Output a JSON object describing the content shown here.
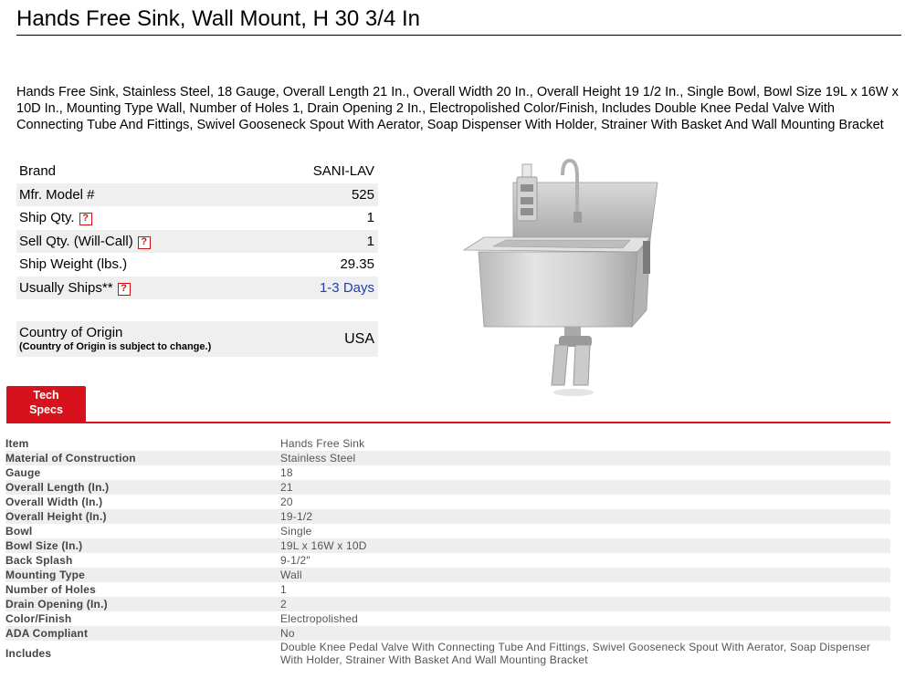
{
  "title": "Hands Free Sink, Wall Mount, H 30 3/4 In",
  "description": "Hands Free Sink, Stainless Steel, 18 Gauge, Overall Length 21 In., Overall Width 20 In., Overall Height 19 1/2 In., Single Bowl, Bowl Size 19L x 16W x 10D In., Mounting Type Wall, Number of Holes 1, Drain Opening 2 In., Electropolished Color/Finish, Includes Double Knee Pedal Valve With Connecting Tube And Fittings, Swivel Gooseneck Spout With Aerator, Soap Dispenser With Holder, Strainer With Basket And Wall Mounting Bracket",
  "props": {
    "brand": {
      "label": "Brand",
      "value": "SANI-LAV"
    },
    "model": {
      "label": "Mfr. Model #",
      "value": "525"
    },
    "ship_qty": {
      "label": "Ship Qty.",
      "value": "1"
    },
    "sell_qty": {
      "label": "Sell Qty. (Will-Call)",
      "value": "1"
    },
    "ship_weight": {
      "label": "Ship Weight (lbs.)",
      "value": "29.35"
    },
    "usually_ships": {
      "label": "Usually Ships**",
      "value": "1-3 Days"
    }
  },
  "help_icon": "?",
  "origin": {
    "label": "Country of Origin",
    "note": "(Country of Origin is subject to change.)",
    "value": "USA"
  },
  "tab": {
    "line1": "Tech",
    "line2": "Specs"
  },
  "specs": [
    {
      "k": "Item",
      "v": "Hands Free Sink"
    },
    {
      "k": "Material of Construction",
      "v": "Stainless Steel"
    },
    {
      "k": "Gauge",
      "v": "18"
    },
    {
      "k": "Overall Length (In.)",
      "v": "21"
    },
    {
      "k": "Overall Width (In.)",
      "v": "20"
    },
    {
      "k": "Overall Height (In.)",
      "v": "19-1/2"
    },
    {
      "k": "Bowl",
      "v": "Single"
    },
    {
      "k": "Bowl Size (In.)",
      "v": "19L x 16W x 10D"
    },
    {
      "k": "Back Splash",
      "v": "9-1/2\""
    },
    {
      "k": "Mounting Type",
      "v": "Wall"
    },
    {
      "k": "Number of Holes",
      "v": "1"
    },
    {
      "k": "Drain Opening (In.)",
      "v": "2"
    },
    {
      "k": "Color/Finish",
      "v": "Electropolished"
    },
    {
      "k": "ADA Compliant",
      "v": "No"
    },
    {
      "k": "Includes",
      "v": "Double Knee Pedal Valve With Connecting Tube And Fittings, Swivel Gooseneck Spout With Aerator, Soap Dispenser With Holder, Strainer With Basket And Wall Mounting Bracket"
    }
  ],
  "colors": {
    "accent": "#d8121c",
    "link": "#2040a8",
    "row_shade": "#efefef"
  }
}
